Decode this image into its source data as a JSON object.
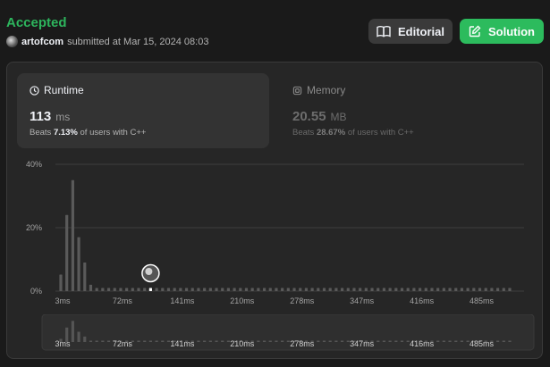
{
  "submission": {
    "status": "Accepted",
    "username": "artofcom",
    "submitted_text": "submitted at Mar 15, 2024 08:03"
  },
  "buttons": {
    "editorial": "Editorial",
    "solution": "Solution"
  },
  "runtime": {
    "label": "Runtime",
    "value": "113",
    "unit": "ms",
    "beats_prefix": "Beats",
    "beats_pct": "7.13%",
    "beats_suffix": "of users with C++"
  },
  "memory": {
    "label": "Memory",
    "value": "20.55",
    "unit": "MB",
    "beats_prefix": "Beats",
    "beats_pct": "28.67%",
    "beats_suffix": "of users with C++"
  },
  "icons": {
    "editorial": "book-open-icon",
    "solution": "edit-icon",
    "runtime": "clock-icon",
    "memory": "chip-icon"
  },
  "colors": {
    "accepted": "#2db55d",
    "solution_button": "#2cbb5d",
    "bar": "#5a5a5a",
    "selected_bar": "#ffffff"
  },
  "chart_data": {
    "type": "bar",
    "y_tick_labels": [
      "40%",
      "20%",
      "0%"
    ],
    "y_ticks": [
      40,
      20,
      0
    ],
    "ylim": [
      0,
      40
    ],
    "x_tick_labels": [
      "3ms",
      "72ms",
      "141ms",
      "210ms",
      "278ms",
      "347ms",
      "416ms",
      "485ms"
    ],
    "x_tick_indices": [
      0,
      10,
      20,
      30,
      40,
      50,
      60,
      70
    ],
    "values": [
      5.2,
      24,
      35,
      17,
      9,
      2,
      1,
      1,
      1,
      1,
      1,
      1,
      1,
      1,
      1,
      1,
      1,
      1,
      1,
      1,
      1,
      1,
      1,
      1,
      1,
      1,
      1,
      1,
      1,
      1,
      1,
      1,
      1,
      1,
      1,
      1,
      1,
      1,
      1,
      1,
      1,
      1,
      1,
      1,
      1,
      1,
      1,
      1,
      1,
      1,
      1,
      1,
      1,
      1,
      1,
      1,
      1,
      1,
      1,
      1,
      1,
      1,
      1,
      1,
      1,
      1,
      1,
      1,
      1,
      1,
      1,
      1,
      1,
      1,
      1,
      1
    ],
    "selected_index": 15,
    "grid": true
  }
}
